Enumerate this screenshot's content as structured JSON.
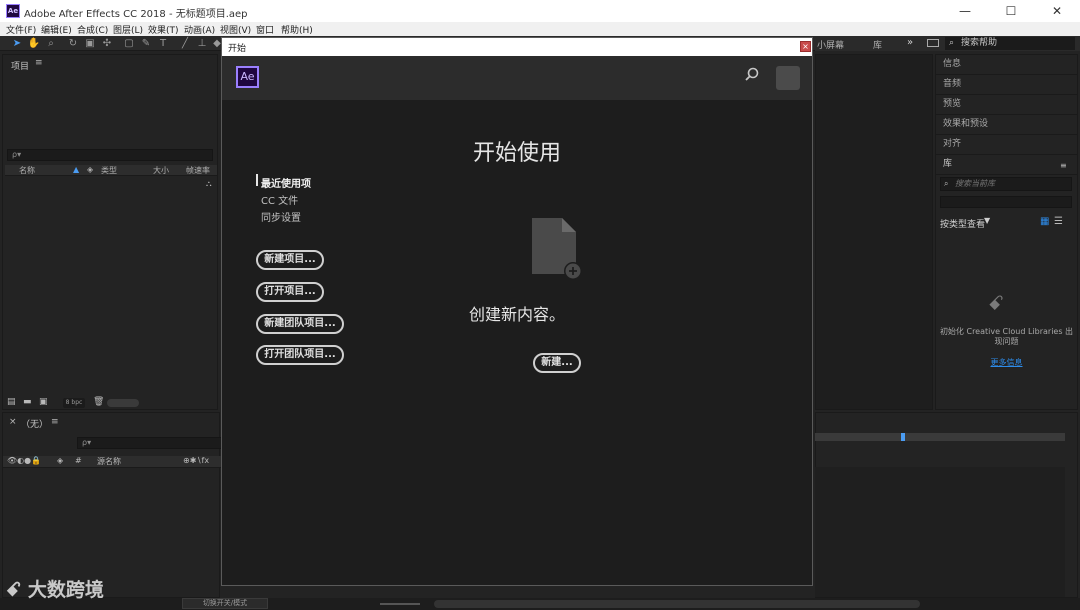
{
  "window": {
    "title": "Adobe After Effects CC 2018 - 无标题项目.aep",
    "app_icon": "Ae",
    "minimize": "—",
    "maximize": "☐",
    "close": "✕"
  },
  "menu": [
    "文件(F)",
    "编辑(E)",
    "合成(C)",
    "图层(L)",
    "效果(T)",
    "动画(A)",
    "视图(V)",
    "窗口",
    "帮助(H)"
  ],
  "workspace": {
    "small_screen": "小屏幕",
    "library": "库",
    "more": "»",
    "search_help": "搜索帮助"
  },
  "project_panel": {
    "title": "项目",
    "menu_icon": "≡",
    "search_placeholder": "ρ▾",
    "col_name": "名称",
    "col_type": "类型",
    "col_size": "大小",
    "col_fps": "帧速率",
    "bpc": "8 bpc"
  },
  "timeline_panel": {
    "close": "×",
    "title": "（无）",
    "menu_icon": "≡",
    "search_placeholder": "ρ▾",
    "col_num": "#",
    "col_source": "源名称",
    "icons": "⊕✱∖fx"
  },
  "right_panels": {
    "items": [
      "信息",
      "音频",
      "预览",
      "效果和预设",
      "对齐"
    ],
    "library_title": "库",
    "library_search_placeholder": "搜索当前库",
    "view_by_type": "按类型查看",
    "lib_message": "初始化 Creative Cloud Libraries 出现问题",
    "more_info": "更多信息"
  },
  "status_bar": {
    "toggle_switches": "切换开关/模式"
  },
  "start_dialog": {
    "title": "开始",
    "close": "×",
    "logo": "Ae",
    "heading": "开始使用",
    "nav": {
      "recent": "最近使用项",
      "cc_files": "CC 文件",
      "sync_settings": "同步设置"
    },
    "buttons": {
      "new_project": "新建项目...",
      "open_project": "打开项目...",
      "new_team_project": "新建团队项目...",
      "open_team_project": "打开团队项目..."
    },
    "create_text": "创建新内容。",
    "new_button": "新建..."
  },
  "watermark": {
    "text": "大数跨境",
    "logo": "ꗃ"
  },
  "colors": {
    "accent": "#9a7fff",
    "panel_bg": "#232323",
    "dialog_bg": "#1d1d1d",
    "link": "#2d8ceb"
  }
}
